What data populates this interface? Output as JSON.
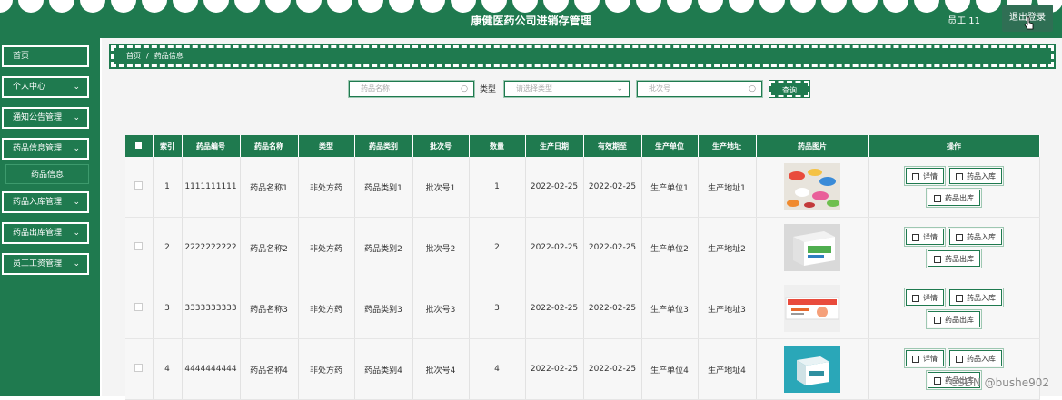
{
  "header": {
    "title": "康健医药公司进销存管理",
    "user": "员工 11",
    "logout_label": "退出登录"
  },
  "sidebar": {
    "items": [
      {
        "label": "首页",
        "chevron": ""
      },
      {
        "label": "个人中心",
        "chevron": "⌄"
      },
      {
        "label": "通知公告管理",
        "chevron": "⌄"
      },
      {
        "label": "药品信息管理",
        "chevron": "⌄"
      },
      {
        "label": "药品入库管理",
        "chevron": "⌄"
      },
      {
        "label": "药品出库管理",
        "chevron": "⌄"
      },
      {
        "label": "员工工资管理",
        "chevron": "⌄"
      }
    ],
    "subitem": "药品信息"
  },
  "breadcrumb": {
    "home": "首页",
    "sep": "/",
    "current": "药品信息"
  },
  "search": {
    "name_placeholder": "药品名称",
    "type_label": "类型",
    "type_placeholder": "请选择类型",
    "batch_placeholder": "批次号",
    "query_label": "查询"
  },
  "table": {
    "headers": [
      "索引",
      "药品编号",
      "药品名称",
      "类型",
      "药品类别",
      "批次号",
      "数量",
      "生产日期",
      "有效期至",
      "生产单位",
      "生产地址",
      "药品图片",
      "操作"
    ],
    "rows": [
      {
        "index": "1",
        "code": "1111111111",
        "name": "药品名称1",
        "type": "非处方药",
        "category": "药品类别1",
        "batch": "批次号1",
        "qty": "1",
        "mfg": "2022-02-25",
        "exp": "2022-02-25",
        "unit": "生产单位1",
        "addr": "生产地址1"
      },
      {
        "index": "2",
        "code": "2222222222",
        "name": "药品名称2",
        "type": "非处方药",
        "category": "药品类别2",
        "batch": "批次号2",
        "qty": "2",
        "mfg": "2022-02-25",
        "exp": "2022-02-25",
        "unit": "生产单位2",
        "addr": "生产地址2"
      },
      {
        "index": "3",
        "code": "3333333333",
        "name": "药品名称3",
        "type": "非处方药",
        "category": "药品类别3",
        "batch": "批次号3",
        "qty": "3",
        "mfg": "2022-02-25",
        "exp": "2022-02-25",
        "unit": "生产单位3",
        "addr": "生产地址3"
      },
      {
        "index": "4",
        "code": "4444444444",
        "name": "药品名称4",
        "type": "非处方药",
        "category": "药品类别4",
        "batch": "批次号4",
        "qty": "4",
        "mfg": "2022-02-25",
        "exp": "2022-02-25",
        "unit": "生产单位4",
        "addr": "生产地址4"
      }
    ],
    "actions": {
      "detail": "详情",
      "stock_in": "药品入库",
      "stock_out": "药品出库"
    }
  },
  "watermark": "CSDN @bushe902",
  "colors": {
    "primary": "#1f7a4f",
    "background": "#f4f4f4"
  }
}
